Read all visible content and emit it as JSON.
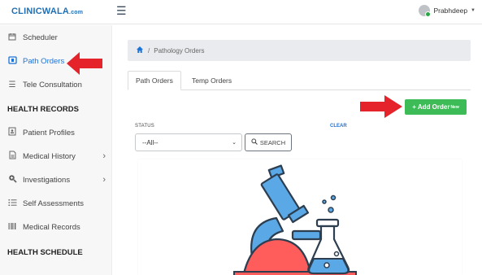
{
  "app": {
    "logo_main": "CLINICWALA",
    "logo_suffix": ".com",
    "user_name": "Prabhdeep"
  },
  "sidebar": {
    "items": [
      {
        "label": "Scheduler",
        "icon": "calendar-icon"
      },
      {
        "label": "Path Orders",
        "icon": "lab-icon",
        "active": true
      },
      {
        "label": "Tele Consultation",
        "icon": "list-icon"
      }
    ],
    "section_health_records": "HEALTH RECORDS",
    "records_items": [
      {
        "label": "Patient Profiles",
        "icon": "profile-icon"
      },
      {
        "label": "Medical History",
        "icon": "document-icon"
      },
      {
        "label": "Investigations",
        "icon": "search-plus-icon"
      },
      {
        "label": "Self Assessments",
        "icon": "checklist-icon"
      },
      {
        "label": "Medical Records",
        "icon": "barcode-icon"
      }
    ],
    "section_health_schedule": "HEALTH SCHEDULE"
  },
  "breadcrumb": {
    "separator": "/",
    "current": "Pathology Orders"
  },
  "tabs": [
    {
      "label": "Path Orders",
      "active": true
    },
    {
      "label": "Temp Orders",
      "active": false
    }
  ],
  "toolbar": {
    "add_order_label": "+ Add Order",
    "add_order_badge": "New"
  },
  "filters": {
    "status_label": "STATUS",
    "clear_label": "CLEAR",
    "status_value": "--All--",
    "search_label": "SEARCH"
  },
  "colors": {
    "primary": "#1a73d9",
    "add_button": "#3dbb57",
    "annotation_arrow": "#e5232b"
  }
}
